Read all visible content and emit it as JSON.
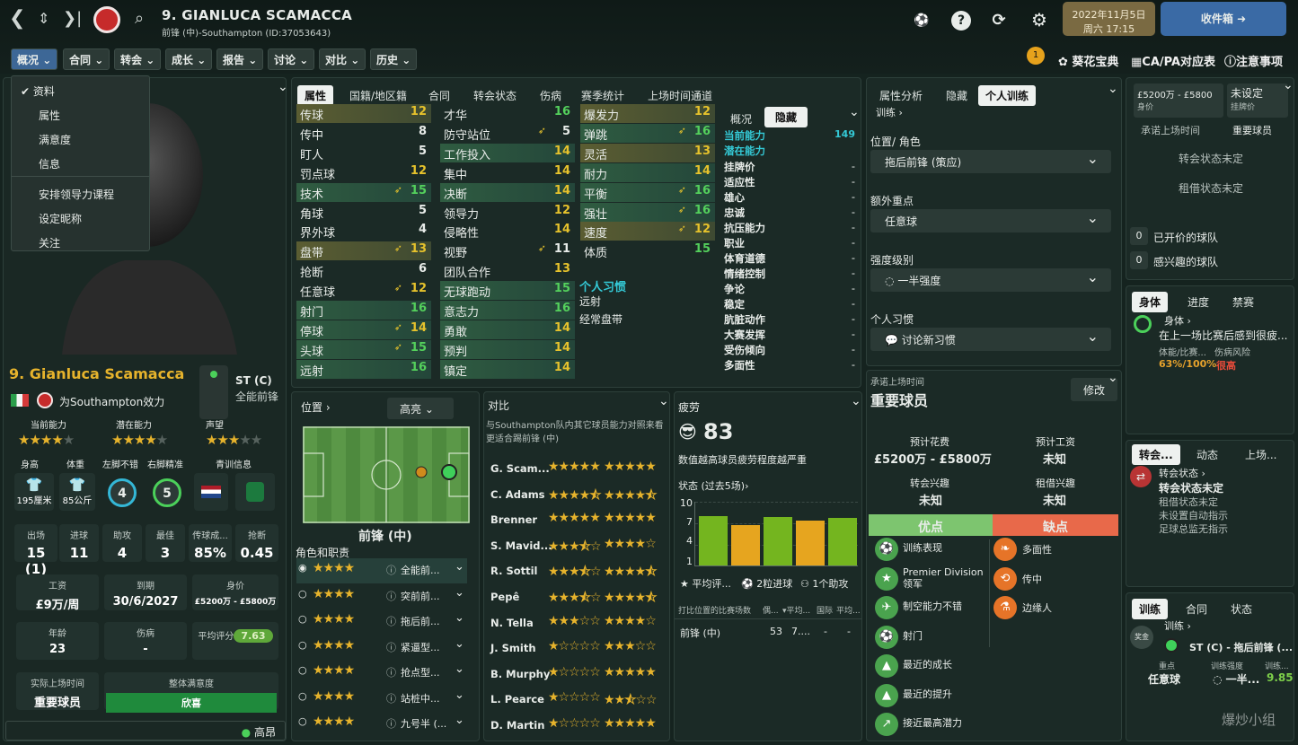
{
  "header": {
    "name": "9. GIANLUCA SCAMACCA",
    "sub": "前锋 (中)-Southampton (ID:37053643)",
    "date": "2022年11月5日",
    "day": "周六 17:15",
    "inbox": "收件箱",
    "notif_count": "1"
  },
  "menu": [
    "概况",
    "合同",
    "转会",
    "成长",
    "报告",
    "讨论",
    "对比",
    "历史"
  ],
  "toplinks": [
    "葵花宝典",
    "CA/PA对应表",
    "注意事项"
  ],
  "dropdown": [
    "资料",
    "属性",
    "满意度",
    "信息",
    "安排领导力课程",
    "设定昵称",
    "关注"
  ],
  "player": {
    "name": "9. Gianluca Scamacca",
    "club": "为Southampton效力",
    "pos": "ST (C)",
    "role": "全能前锋",
    "ca_label": "当前能力",
    "pa_label": "潜在能力",
    "rep_label": "声望",
    "height_label": "身高",
    "weight_label": "体重",
    "lfoot_label": "左脚不错",
    "rfoot_label": "右脚精准",
    "youth_label": "青训信息",
    "height": "195厘米",
    "weight": "85公斤",
    "lfoot": "4",
    "rfoot": "5",
    "apps_label": "出场",
    "goals_label": "进球",
    "assists_label": "助攻",
    "best_label": "最佳",
    "pass_label": "传球成...",
    "tackle_label": "抢断",
    "apps": "15 (1)",
    "goals": "11",
    "assists": "4",
    "best": "3",
    "pass": "85%",
    "tackle": "0.45",
    "wage_label": "工资",
    "expires_label": "到期",
    "value_label": "身价",
    "wage": "£9万/周",
    "expires": "30/6/2027",
    "value": "£5200万 - £5800万",
    "age_label": "年龄",
    "injury_label": "伤病",
    "rating_label": "平均评分",
    "age": "23",
    "injury": "-",
    "rating": "7.63",
    "playing_label": "实际上场时间",
    "playing": "重要球员",
    "morale_label": "整体满意度",
    "morale": "欣喜",
    "bottom": "高昂"
  },
  "attr_tabs": [
    "属性",
    "国籍/地区籍",
    "合同",
    "转会状态",
    "伤病",
    "赛季统计",
    "上场时间通道"
  ],
  "technical": [
    [
      "传球",
      "12"
    ],
    [
      "传中",
      "8"
    ],
    [
      "盯人",
      "5"
    ],
    [
      "罚点球",
      "12"
    ],
    [
      "技术",
      "15"
    ],
    [
      "角球",
      "5"
    ],
    [
      "界外球",
      "4"
    ],
    [
      "盘带",
      "13"
    ],
    [
      "抢断",
      "6"
    ],
    [
      "任意球",
      "12"
    ],
    [
      "射门",
      "16"
    ],
    [
      "停球",
      "14"
    ],
    [
      "头球",
      "15"
    ],
    [
      "远射",
      "16"
    ]
  ],
  "mental": [
    [
      "才华",
      "16"
    ],
    [
      "防守站位",
      "5"
    ],
    [
      "工作投入",
      "14"
    ],
    [
      "集中",
      "14"
    ],
    [
      "决断",
      "14"
    ],
    [
      "领导力",
      "12"
    ],
    [
      "侵略性",
      "14"
    ],
    [
      "视野",
      "11"
    ],
    [
      "团队合作",
      "13"
    ],
    [
      "无球跑动",
      "15"
    ],
    [
      "意志力",
      "16"
    ],
    [
      "勇敢",
      "14"
    ],
    [
      "预判",
      "14"
    ],
    [
      "镇定",
      "14"
    ]
  ],
  "physical": [
    [
      "爆发力",
      "12"
    ],
    [
      "弹跳",
      "16"
    ],
    [
      "灵活",
      "13"
    ],
    [
      "耐力",
      "14"
    ],
    [
      "平衡",
      "16"
    ],
    [
      "强壮",
      "16"
    ],
    [
      "速度",
      "12"
    ],
    [
      "体质",
      "15"
    ]
  ],
  "habits": {
    "title": "个人习惯",
    "items": [
      "远射",
      "经常盘带"
    ]
  },
  "hidden": {
    "tab1": "概况",
    "tab2": "隐藏",
    "ca": "当前能力",
    "ca_val": "149",
    "pa": "潜在能力",
    "rows": [
      "挂牌价",
      "适应性",
      "雄心",
      "忠诚",
      "抗压能力",
      "职业",
      "体育道德",
      "情绪控制",
      "争论",
      "稳定",
      "肮脏动作",
      "大赛发挥",
      "受伤倾向",
      "多面性"
    ],
    "dash": "-"
  },
  "position": {
    "title": "位置",
    "highlight": "高亮",
    "pos": "前锋 (中)",
    "roles_title": "角色和职责",
    "roles": [
      "全能前...",
      "突前前...",
      "拖后前...",
      "紧逼型...",
      "抢点型...",
      "站桩中...",
      "九号半 (..."
    ]
  },
  "compare": {
    "title": "对比",
    "desc": "与Southampton队内其它球员能力对照来看更适合踢前锋 (中)",
    "players": [
      "G. Scam...",
      "C. Adams",
      "Brenner",
      "S. Mavid...",
      "R. Sottil",
      "Pepê",
      "N. Tella",
      "J. Smith",
      "B. Murphy",
      "L. Pearce",
      "D. Martin"
    ],
    "ratings": [
      [
        5,
        5
      ],
      [
        4.5,
        4.5
      ],
      [
        5,
        5
      ],
      [
        3.5,
        4
      ],
      [
        3.5,
        4.5
      ],
      [
        3.5,
        4.5
      ],
      [
        3,
        4
      ],
      [
        1,
        3
      ],
      [
        1,
        5
      ],
      [
        1,
        2.5
      ],
      [
        1,
        5
      ]
    ]
  },
  "fatigue": {
    "title": "疲劳",
    "value": "83",
    "desc": "数值越高球员疲劳程度越严重",
    "status": "状态 (过去5场)",
    "legend1": "平均评...",
    "legend2": "2粒进球",
    "legend3": "1个助攻",
    "table_h": "打比位置的比赛场数",
    "cols": [
      "偶...",
      "平均...",
      "国际",
      "平均..."
    ],
    "row": [
      "前锋 (中)",
      "53",
      "7....",
      "-",
      "-"
    ],
    "yticks": [
      "10",
      "7",
      "4",
      "1"
    ]
  },
  "chart_data": {
    "type": "bar",
    "title": "状态 (过去5场)",
    "values": [
      7.9,
      6.6,
      7.7,
      7.3,
      7.6
    ],
    "colors": [
      "#74b51f",
      "#e6a51f",
      "#74b51f",
      "#e6a51f",
      "#74b51f"
    ],
    "ylim": [
      1,
      10
    ]
  },
  "training": {
    "tabs": [
      "属性分析",
      "隐藏",
      "个人训练"
    ],
    "crumb": "训练",
    "pos_label": "位置/ 角色",
    "pos_val": "拖后前锋 (策应)",
    "focus_label": "额外重点",
    "focus_val": "任意球",
    "int_label": "强度级别",
    "int_val": "一半强度",
    "habit_label": "个人习惯",
    "habit_val": "讨论新习惯"
  },
  "promise": {
    "label": "承诺上场时间",
    "value": "重要球员",
    "edit": "修改",
    "fee_l": "预计花费",
    "fee": "£5200万 - £5800万",
    "wage_l": "预计工资",
    "wage": "未知",
    "tint_l": "转会兴趣",
    "tint": "未知",
    "lint_l": "租借兴趣",
    "lint": "未知",
    "pros": "优点",
    "cons": "缺点",
    "pro_items": [
      "训练表现",
      "Premier Division领军",
      "制空能力不错",
      "射门",
      "最近的成长",
      "最近的提升",
      "接近最高潜力"
    ],
    "con_items": [
      "多面性",
      "传中",
      "边缘人"
    ]
  },
  "right": {
    "value": "£5200万 - £5800",
    "value_l": "身价",
    "status": "未设定",
    "status_l": "挂牌价",
    "promised": "承诺上场时间",
    "role": "重要球员",
    "transfer": "转会状态未定",
    "loan": "租借状态未定",
    "offers": "已开价的球队",
    "interest": "感兴趣的球队",
    "zero": "0",
    "fit_tabs": [
      "身体",
      "进度",
      "禁赛"
    ],
    "fit_title": "身体",
    "fit_desc": "在上一场比赛后感到很疲...",
    "fit_l1": "体能/比赛...",
    "fit_l2": "伤病风险",
    "fit_v1": "63%/100%",
    "fit_v2": "很高",
    "ts_tabs": [
      "转会...",
      "动态",
      "上场..."
    ],
    "ts_title": "转会状态",
    "ts_sub": "转会状态未定",
    "ts_items": [
      "租借状态未定",
      "未设置自动指示",
      "足球总监无指示"
    ],
    "tr_tabs": [
      "训练",
      "合同",
      "状态"
    ],
    "tr_title": "训练",
    "tr_role": "ST (C) - 拖后前锋 (...",
    "tr_focus_l": "重点",
    "tr_focus": "任意球",
    "tr_int_l": "训练强度",
    "tr_int": "一半...",
    "tr_rate_l": "训练...",
    "tr_rate": "9.85",
    "badge": "奖金"
  },
  "watermark": "爆炒小组"
}
